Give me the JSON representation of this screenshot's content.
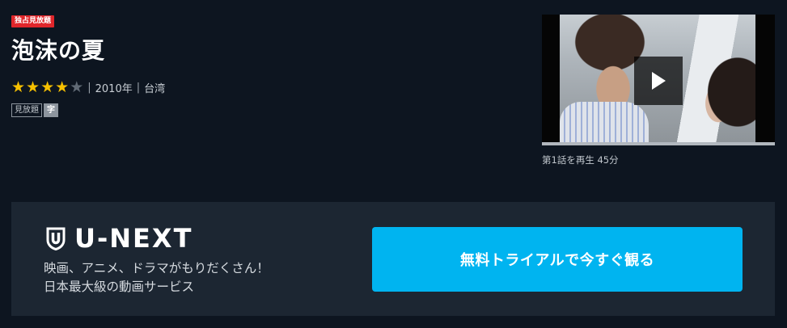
{
  "badge": "独占見放題",
  "title": "泡沫の夏",
  "rating": {
    "value": 4,
    "max": 5
  },
  "meta": {
    "year": "2010年",
    "region": "台湾",
    "separator": "|"
  },
  "tags": {
    "plan": "見放題",
    "subtitle": "字"
  },
  "video": {
    "progress": 1.0,
    "episode_label": "第1話を再生",
    "duration": "45分",
    "play_icon": "play-icon"
  },
  "promo": {
    "logo_text": "U-NEXT",
    "logo_icon": "u-next-shield-icon",
    "tagline_1": "映画、アニメ、ドラマがもりだくさん！",
    "tagline_2": "日本最大級の動画サービス",
    "cta_label": "無料トライアルで今すぐ観る"
  },
  "colors": {
    "background": "#0d1520",
    "badge": "#e0262b",
    "star": "#f6c000",
    "promo_background": "#1c2632",
    "cta": "#00b4f0"
  }
}
